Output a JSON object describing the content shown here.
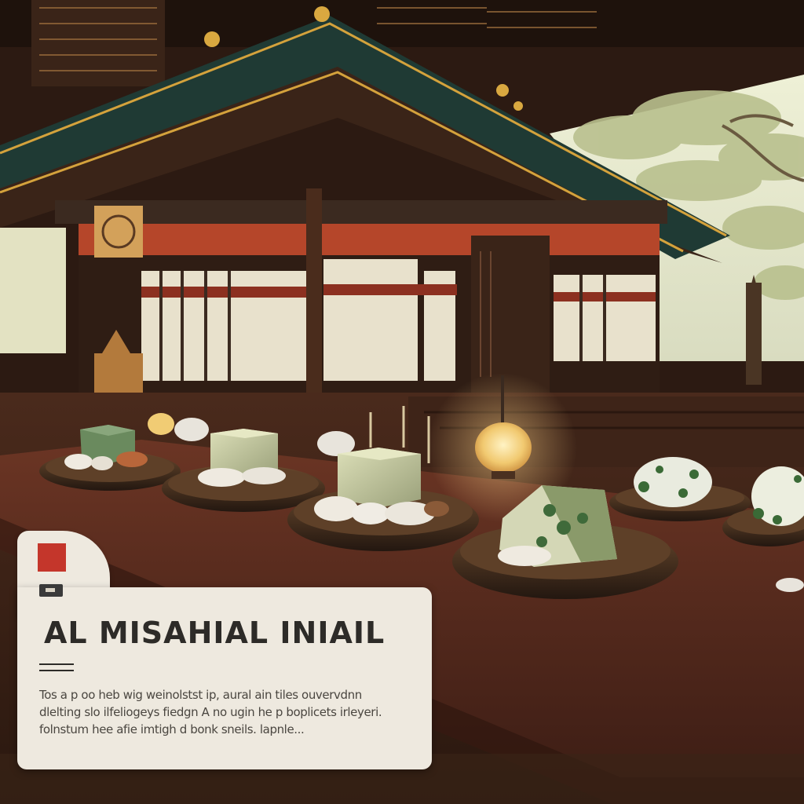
{
  "card": {
    "title": "AL MISAHIAL INIAIL",
    "body_lines": [
      "Tos a p oo heb wig weinolstst ip, aural ain tiles ouvervdnn",
      "dlelting slo ilfeliogeys fiedgn A no ugin he p boplicets irleyeri.",
      "folnstum hee afie imtigh d bonk sneils. lapnle..."
    ]
  },
  "colors": {
    "card_background": "#eee9df",
    "accent": "#c4362b",
    "title_text": "#2d2b28",
    "wood": "#5a2e1e"
  },
  "icons": [
    "red-square-icon",
    "tag-icon"
  ]
}
